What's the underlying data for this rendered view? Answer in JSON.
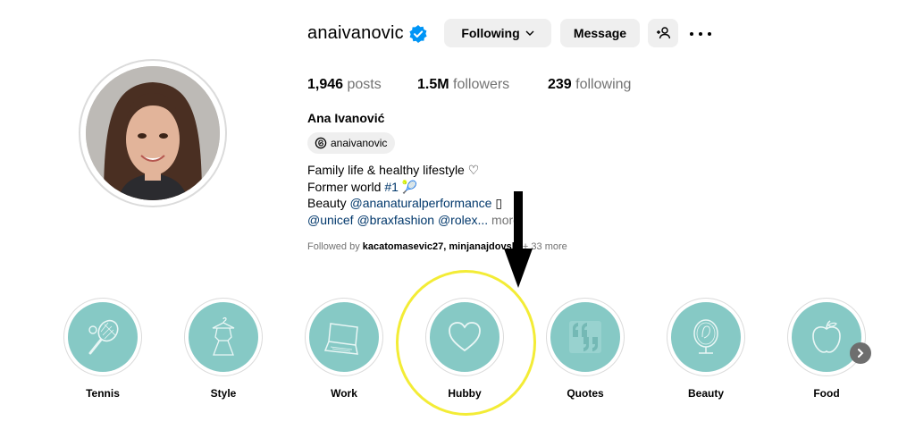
{
  "profile": {
    "username": "anaivanovic",
    "full_name": "Ana Ivanović",
    "threads_handle": "anaivanovic",
    "verified_icon": "verified-badge-icon"
  },
  "actions": {
    "following_label": "Following",
    "message_label": "Message",
    "add_user_icon": "add-person-icon",
    "more_icon": "more-options-icon"
  },
  "stats": {
    "posts_count": "1,946",
    "posts_label": "posts",
    "followers_count": "1.5M",
    "followers_label": "followers",
    "following_count": "239",
    "following_label": "following"
  },
  "bio": {
    "line1": "Family life & healthy lifestyle ♡",
    "line2_prefix": "Former world ",
    "line2_link": "#1",
    "line2_emoji": "🎾",
    "line3_prefix": "Beauty ",
    "line3_link": "@ananaturalperformance",
    "line3_suffix": " ▯",
    "line4_link": "@unicef @braxfashion @rolex...",
    "more_label": " more"
  },
  "followed_by": {
    "prefix": "Followed by ",
    "names": "kacatomasevic27, minjanajdovski",
    "suffix": " + 33 more"
  },
  "highlights": [
    {
      "label": "Tennis",
      "icon": "tennis-racket-icon"
    },
    {
      "label": "Style",
      "icon": "dress-hanger-icon"
    },
    {
      "label": "Work",
      "icon": "laptop-icon"
    },
    {
      "label": "Hubby",
      "icon": "heart-icon"
    },
    {
      "label": "Quotes",
      "icon": "quote-marks-icon"
    },
    {
      "label": "Beauty",
      "icon": "mirror-icon"
    },
    {
      "label": "Food",
      "icon": "apple-icon"
    }
  ],
  "colors": {
    "highlight_fill": "#86c9c5",
    "annotation_circle": "#f3ec36",
    "link": "#00376b",
    "verified": "#0095f6"
  }
}
